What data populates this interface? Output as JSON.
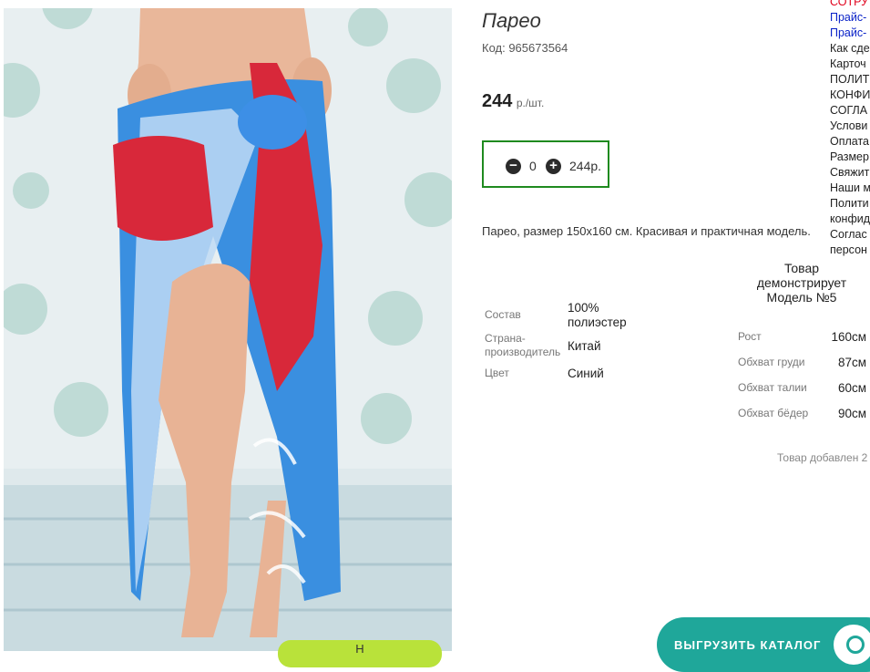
{
  "product": {
    "title": "Парео",
    "code": "Код: 965673564",
    "price": "244",
    "price_unit": "р./шт.",
    "quantity": "0",
    "sum": "244р.",
    "description": "Парео, размер 150х160 см. Красивая и практичная модель."
  },
  "attributes": [
    {
      "label": "Состав",
      "value": "100% полиэстер"
    },
    {
      "label": "Страна-производитель",
      "value": "Китай"
    },
    {
      "label": "Цвет",
      "value": "Синий"
    }
  ],
  "model": {
    "title": "Товар демонстрирует Модель №5",
    "params": [
      {
        "label": "Рост",
        "value": "160см"
      },
      {
        "label": "Обхват груди",
        "value": "87см"
      },
      {
        "label": "Обхват талии",
        "value": "60см"
      },
      {
        "label": "Обхват бёдер",
        "value": "90см"
      }
    ]
  },
  "added_text": "Товар добавлен 2",
  "side_menu": [
    {
      "text": "СОТРУ",
      "color": "#e0001b"
    },
    {
      "text": "Прайс-",
      "color": "#0a22c8"
    },
    {
      "text": "Прайс-",
      "color": "#0a22c8"
    },
    {
      "text": "Как сде",
      "color": "#222222"
    },
    {
      "text": "Карточ",
      "color": "#222222"
    },
    {
      "text": "ПОЛИТ",
      "color": "#222222"
    },
    {
      "text": "КОНФИ",
      "color": "#222222"
    },
    {
      "text": "СОГЛА",
      "color": "#222222"
    },
    {
      "text": "Услови",
      "color": "#222222"
    },
    {
      "text": "Оплата",
      "color": "#222222"
    },
    {
      "text": "Размер",
      "color": "#222222"
    },
    {
      "text": "Свяжит",
      "color": "#222222"
    },
    {
      "text": "Наши м",
      "color": "#222222"
    },
    {
      "text": "Полити",
      "color": "#222222"
    },
    {
      "text": "конфид",
      "color": "#222222"
    },
    {
      "text": "Соглас",
      "color": "#222222"
    },
    {
      "text": "персон",
      "color": "#222222"
    }
  ],
  "catalog_button": "ВЫГРУЗИТЬ КАТАЛОГ",
  "green_button": "Н",
  "colors": {
    "qty_border": "#1f8a1f",
    "catalog": "#1fa79a",
    "pareo_blue": "#3a8fe0",
    "pareo_red": "#d8283a"
  },
  "icons": [
    "minus-icon",
    "plus-icon",
    "search-icon"
  ]
}
